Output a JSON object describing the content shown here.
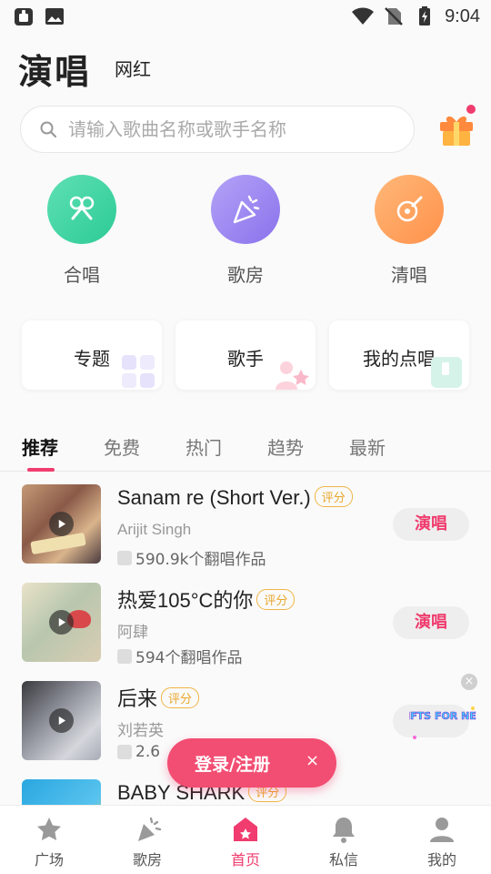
{
  "status_bar": {
    "time": "9:04"
  },
  "header": {
    "title": "演唱",
    "tab": "网红"
  },
  "search": {
    "placeholder": "请输入歌曲名称或歌手名称"
  },
  "features": [
    {
      "label": "合唱",
      "color": "#3ed6a4"
    },
    {
      "label": "歌房",
      "color": "#9b86f0"
    },
    {
      "label": "清唱",
      "color": "#ffa25c"
    }
  ],
  "cards": [
    {
      "label": "专题"
    },
    {
      "label": "歌手"
    },
    {
      "label": "我的点唱"
    }
  ],
  "tabs": [
    "推荐",
    "免费",
    "热门",
    "趋势",
    "最新"
  ],
  "songs": [
    {
      "title": "Sanam re (Short Ver.)",
      "badge": "评分",
      "artist": "Arijit Singh",
      "covers": "590.9k个翻唱作品",
      "action": "演唱"
    },
    {
      "title": "热爱105°C的你",
      "badge": "评分",
      "artist": "阿肆",
      "covers": "594个翻唱作品",
      "action": "演唱"
    },
    {
      "title": "后来",
      "badge": "评分",
      "artist": "刘若英",
      "covers": "2.6"
    },
    {
      "title": "BABY SHARK",
      "badge": "评分"
    }
  ],
  "login": {
    "label": "登录/注册",
    "close": "×"
  },
  "ad": {
    "close": "×",
    "text": "GIFTS FOR NEW"
  },
  "bottom_nav": [
    {
      "label": "广场"
    },
    {
      "label": "歌房"
    },
    {
      "label": "首页"
    },
    {
      "label": "私信"
    },
    {
      "label": "我的"
    }
  ],
  "colors": {
    "accent": "#f03c6e",
    "badge": "#e9a72c"
  }
}
